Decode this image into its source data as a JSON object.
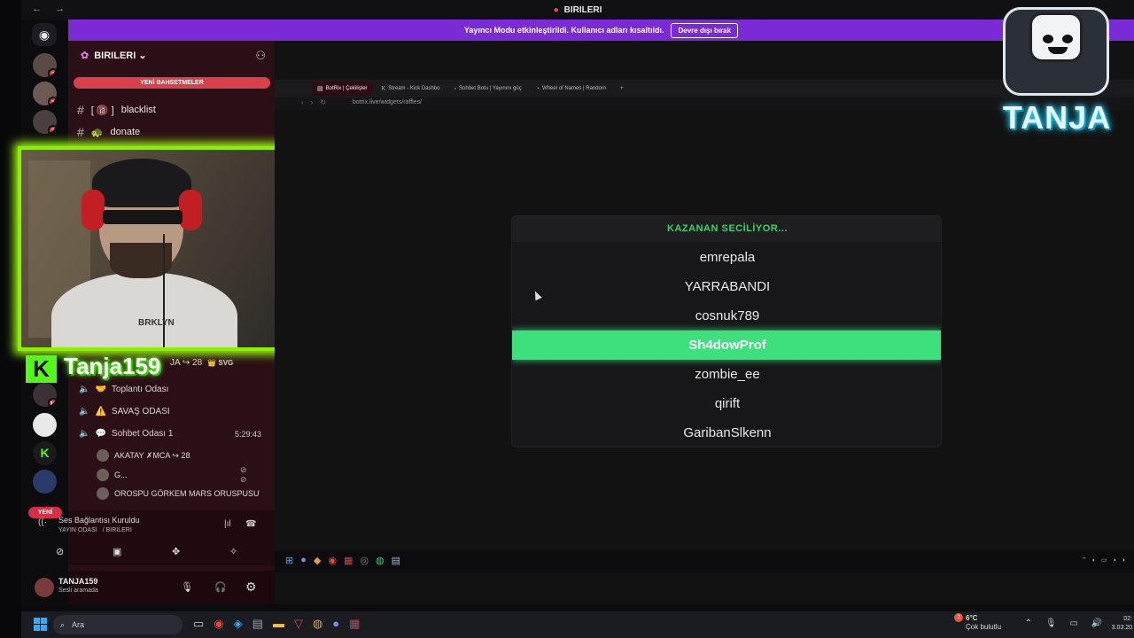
{
  "window": {
    "title": "BIRILERI",
    "nav_glyphs": "← →"
  },
  "streamer_mode": {
    "message": "Yayıncı Modu etkinleştirildi. Kullanıcı adları kısaltıldı.",
    "button": "Devre dışı bırak"
  },
  "server_rail": {
    "badges": [
      "2",
      "1",
      "3",
      "12"
    ],
    "new_label": "YENİ"
  },
  "server": {
    "name": "BIRILERI",
    "new_mentions": "YENİ BAHSETMELER"
  },
  "channels": [
    {
      "name": "blacklist",
      "prefix": "[ 🔞 ]"
    },
    {
      "name": "donate",
      "prefix": "🐢"
    }
  ],
  "voice_channels": [
    {
      "name": "Toplantı Odası",
      "icon": "🤝"
    },
    {
      "name": "SAVAŞ ODASI",
      "icon": "⚠️"
    },
    {
      "name": "Sohbet Odası 1",
      "icon": "💬",
      "timer": "5:29:43"
    }
  ],
  "voice_top_row": {
    "text": "JA ↪ 28",
    "badge": "👑 SVG"
  },
  "members": [
    {
      "name": "AKATAY ✗MCA ↪ 28"
    },
    {
      "name": "G..."
    },
    {
      "name": "OROSPU GÖRKEM MARS ORUSPUSU"
    }
  ],
  "voice_status": {
    "title": "Ses Bağlantısı Kuruldu",
    "channel": "YAYIN ODASI",
    "server": "/ BIRILERI"
  },
  "user": {
    "name": "TANJA159",
    "status": "Sesli aramada"
  },
  "webcam": {
    "shirt_text": "BRKLYN",
    "kick_name": "Tanja159",
    "kick_logo": "K"
  },
  "browser": {
    "tabs": [
      {
        "label": "BotRix | Çekilişler",
        "active": true
      },
      {
        "label": "Stream - Kick Dashbo",
        "active": false
      },
      {
        "label": "Sohbet Botu | Yayınını güç",
        "active": false
      },
      {
        "label": "Wheel of Names | Random",
        "active": false
      }
    ],
    "url": "botrix.live/widgets/raffles/"
  },
  "raffle": {
    "header": "KAZANAN SECİLİYOR...",
    "entries": [
      "emrepala",
      "YARRABANDI",
      "cosnuk789",
      "Sh4dowProf",
      "zombie_ee",
      "qirift",
      "GaribanSlkenn"
    ],
    "winner_index": 3
  },
  "logo": {
    "text": "TANJA"
  },
  "taskbar": {
    "search_placeholder": "Ara",
    "weather_temp": "6°C",
    "weather_desc": "Çok bulutlu",
    "weather_badge": "2",
    "time": "02:",
    "date": "3.03.20"
  },
  "colors": {
    "accent_purple": "#7b2bd6",
    "kick_green": "#53fc18",
    "winner_green": "#3ee07e",
    "header_green": "#3ad16c"
  }
}
